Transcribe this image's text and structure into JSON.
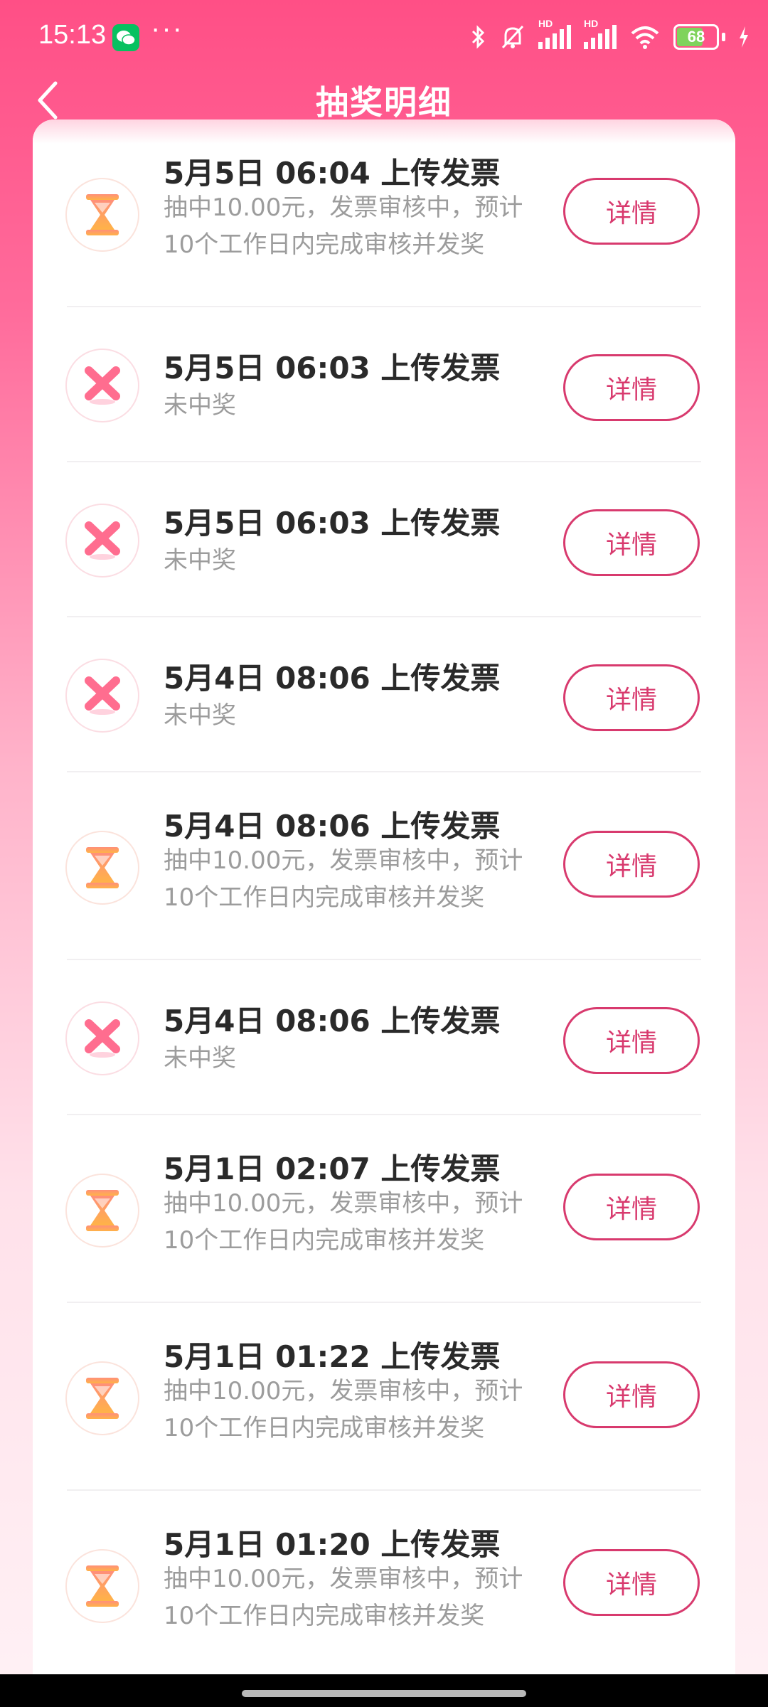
{
  "status_bar": {
    "time": "15:13",
    "dots": "···",
    "hd_label": "HD",
    "battery": "68"
  },
  "header": {
    "title": "抽奖明细"
  },
  "colors": {
    "accent": "#d83a6e",
    "header_pink": "#ff4f86"
  },
  "records": [
    {
      "title": "5月5日 06:04 上传发票",
      "status": "pending",
      "icon": "hourglass-icon",
      "subtitle": "抽中10.00元，发票审核中，预计10个工作日内完成审核并发奖",
      "button": "详情"
    },
    {
      "title": "5月5日 06:03 上传发票",
      "status": "fail",
      "icon": "cross-icon",
      "subtitle": "未中奖",
      "button": "详情"
    },
    {
      "title": "5月5日 06:03 上传发票",
      "status": "fail",
      "icon": "cross-icon",
      "subtitle": "未中奖",
      "button": "详情"
    },
    {
      "title": "5月4日 08:06 上传发票",
      "status": "fail",
      "icon": "cross-icon",
      "subtitle": "未中奖",
      "button": "详情"
    },
    {
      "title": "5月4日 08:06 上传发票",
      "status": "pending",
      "icon": "hourglass-icon",
      "subtitle": "抽中10.00元，发票审核中，预计10个工作日内完成审核并发奖",
      "button": "详情"
    },
    {
      "title": "5月4日 08:06 上传发票",
      "status": "fail",
      "icon": "cross-icon",
      "subtitle": "未中奖",
      "button": "详情"
    },
    {
      "title": "5月1日 02:07 上传发票",
      "status": "pending",
      "icon": "hourglass-icon",
      "subtitle": "抽中10.00元，发票审核中，预计10个工作日内完成审核并发奖",
      "button": "详情"
    },
    {
      "title": "5月1日 01:22 上传发票",
      "status": "pending",
      "icon": "hourglass-icon",
      "subtitle": "抽中10.00元，发票审核中，预计10个工作日内完成审核并发奖",
      "button": "详情"
    },
    {
      "title": "5月1日 01:20 上传发票",
      "status": "pending",
      "icon": "hourglass-icon",
      "subtitle": "抽中10.00元，发票审核中，预计10个工作日内完成审核并发奖",
      "button": "详情"
    }
  ]
}
